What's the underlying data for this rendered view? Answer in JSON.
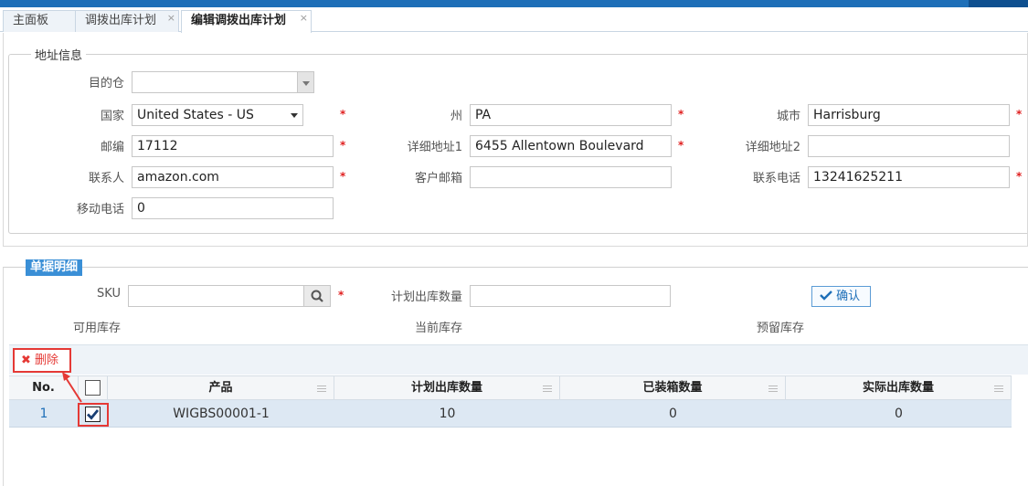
{
  "tabs": [
    {
      "label": "主面板"
    },
    {
      "label": "调拨出库计划",
      "close": "×"
    },
    {
      "label": "编辑调拨出库计划",
      "close": "×"
    }
  ],
  "address": {
    "legend": "地址信息",
    "warehouse": {
      "label": "目的仓",
      "value": ""
    },
    "country": {
      "label": "国家",
      "value": "United States - US"
    },
    "state": {
      "label": "州",
      "value": "PA"
    },
    "city": {
      "label": "城市",
      "value": "Harrisburg"
    },
    "zip": {
      "label": "邮编",
      "value": "17112"
    },
    "address1": {
      "label": "详细地址1",
      "value": "6455 Allentown Boulevard"
    },
    "address2": {
      "label": "详细地址2",
      "value": ""
    },
    "contact": {
      "label": "联系人",
      "value": "amazon.com"
    },
    "email": {
      "label": "客户邮箱",
      "value": ""
    },
    "phone": {
      "label": "联系电话",
      "value": "13241625211"
    },
    "mobile": {
      "label": "移动电话",
      "value": "0"
    },
    "required_mark": "*"
  },
  "details": {
    "title": "单据明细",
    "sku": {
      "label": "SKU",
      "value": ""
    },
    "planned_qty": {
      "label": "计划出库数量",
      "value": ""
    },
    "confirm_label": "确认",
    "available_stock_label": "可用库存",
    "current_stock_label": "当前库存",
    "reserved_stock_label": "预留库存"
  },
  "toolbar": {
    "delete_label": "删除"
  },
  "grid": {
    "columns": [
      "No.",
      "",
      "产品",
      "计划出库数量",
      "已装箱数量",
      "实际出库数量"
    ],
    "rows": [
      {
        "no": "1",
        "checked": true,
        "product": "WIGBS00001-1",
        "planned": "10",
        "packed": "0",
        "actual": "0"
      }
    ]
  },
  "colors": {
    "accent": "#1e6fb8",
    "highlight": "#e53935",
    "selected_row": "#dde8f3"
  }
}
